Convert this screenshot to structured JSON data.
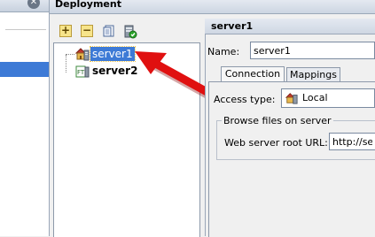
{
  "deployment": {
    "title": "Deployment"
  },
  "left_panel": {
    "close_glyph": "✕"
  },
  "toolbar": {
    "add_glyph": "+",
    "remove_glyph": "−",
    "icons": [
      "add-icon",
      "remove-icon",
      "copy-icon",
      "validate-icon"
    ]
  },
  "tree": {
    "items": [
      {
        "label": "server1",
        "selected": true,
        "icon": "server-local-icon"
      },
      {
        "label": "server2",
        "selected": false,
        "icon": "server-ftp-icon"
      }
    ]
  },
  "details": {
    "title": "server1",
    "name_label": "Name:",
    "name_value": "server1",
    "tabs": [
      {
        "label": "Connection",
        "active": true
      },
      {
        "label": "Mappings",
        "active": false
      }
    ],
    "access_type_label": "Access type:",
    "access_type_value": "Local",
    "browse_group_label": "Browse files on server",
    "root_url_label": "Web server root URL:",
    "root_url_value": "http://ser"
  },
  "colors": {
    "selection": "#3d7ad6",
    "arrow": "#e01010",
    "header": "#ccd5e2"
  }
}
